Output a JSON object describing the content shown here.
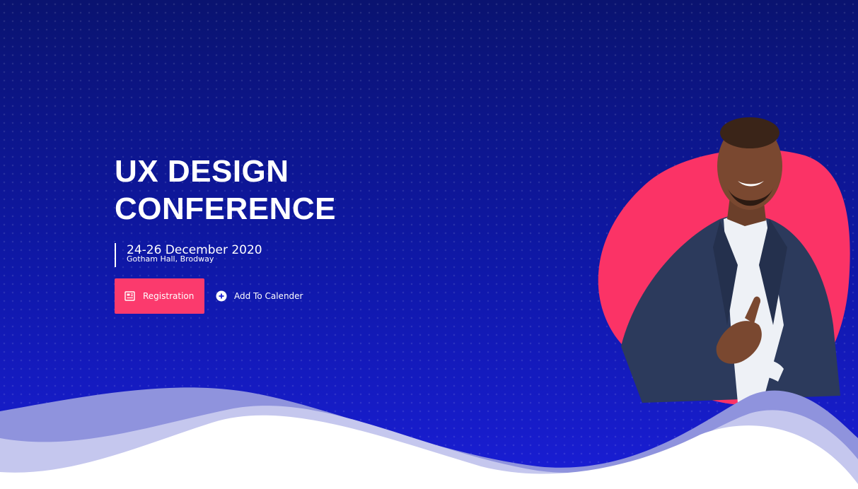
{
  "hero": {
    "title_line1": "UX DESIGN",
    "title_line2": "CONFERENCE",
    "date": "24-26 December 2020",
    "venue": "Gotham Hall, Brodway"
  },
  "actions": {
    "registration_label": "Registration",
    "calendar_label": "Add To Calender"
  },
  "icons": {
    "registration": "newspaper-icon",
    "calendar": "plus-circle-icon"
  },
  "colors": {
    "background_top": "#0a1370",
    "background_bottom": "#1a1ed6",
    "accent": "#fb3a6d",
    "wave_light": "#c5c7ee",
    "wave_mid": "#8f93dd"
  }
}
